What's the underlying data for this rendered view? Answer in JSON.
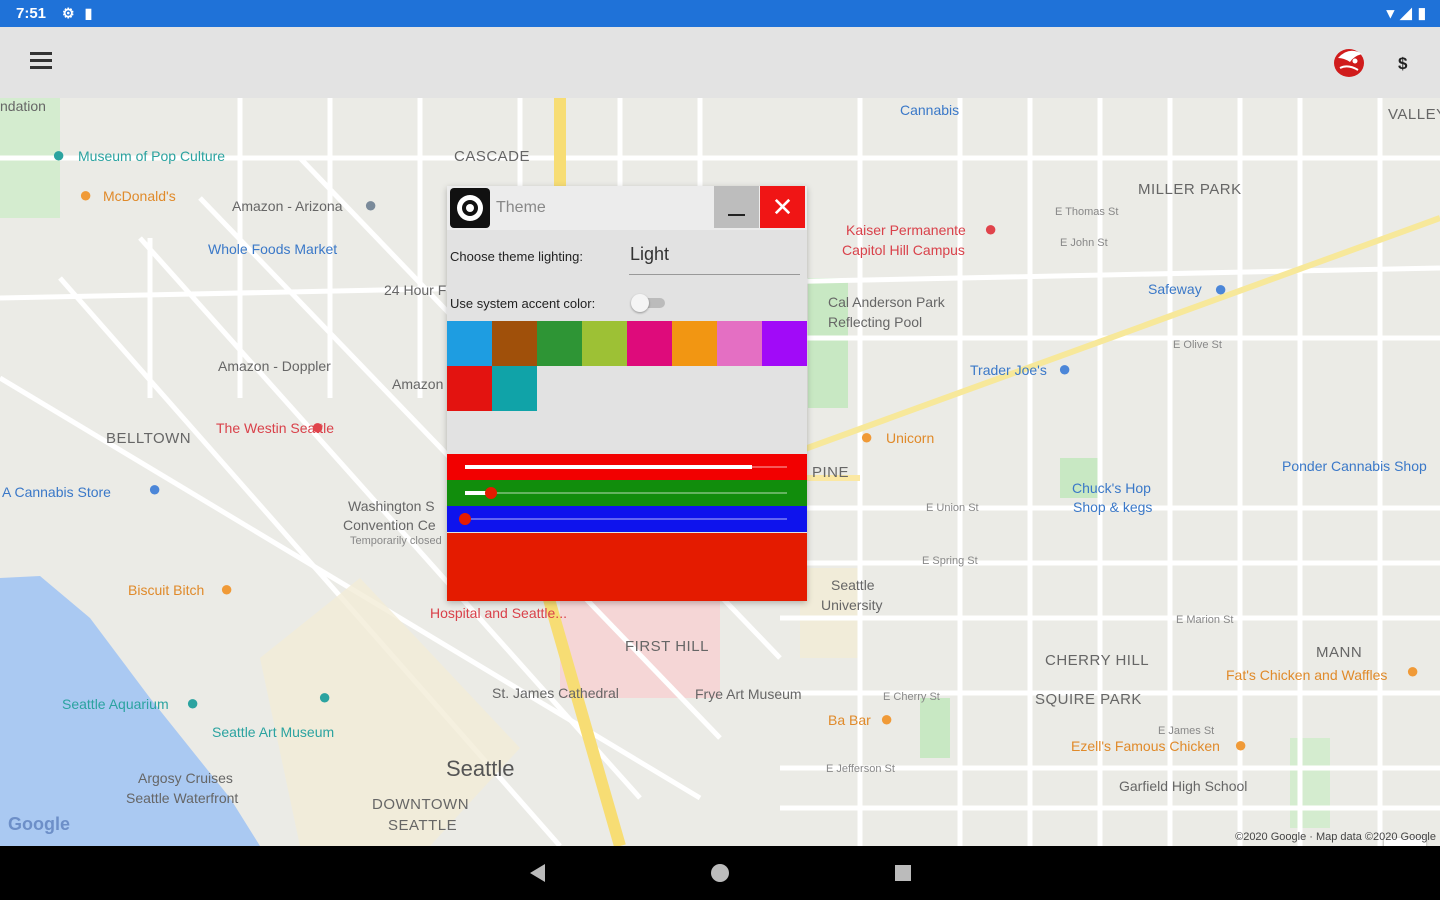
{
  "status_bar": {
    "time": "7:51",
    "icons": [
      "gear-icon",
      "sd-card-icon"
    ],
    "right_icons": [
      "wifi-icon",
      "signal-icon",
      "battery-icon"
    ]
  },
  "app_bar": {
    "currency": "$"
  },
  "dialog": {
    "title": "Theme",
    "close_glyph": "✕",
    "lighting_label": "Choose theme lighting:",
    "lighting_value": "Light",
    "accent_label": "Use system accent color:",
    "accent_toggle_on": false,
    "swatches": [
      "#1e9de1",
      "#a0500a",
      "#2e9535",
      "#9dc135",
      "#de0b7b",
      "#f29612",
      "#e46fc3",
      "#a10af8",
      "#e31310",
      "#10a3a8"
    ],
    "sliders": [
      {
        "name": "red",
        "color": "#f20000",
        "value_fraction": 0.89
      },
      {
        "name": "green",
        "color": "#118d0c",
        "value_fraction": 0.08
      },
      {
        "name": "blue",
        "color": "#0e13ed",
        "value_fraction": 0.0
      }
    ],
    "preview_color": "#e41b00"
  },
  "map": {
    "city_label": "Seattle",
    "areas": [
      "CASCADE",
      "MILLER PARK",
      "BELLTOWN",
      "FIRST HILL",
      "CHERRY HILL",
      "SQUIRE PARK",
      "DOWNTOWN",
      "SEATTLE",
      "MANN",
      "PINE",
      "VALLEY"
    ],
    "pois": [
      "Museum of Pop Culture",
      "McDonald's",
      "Amazon - Arizona",
      "Whole Foods Market",
      "24 Hour F",
      "Amazon - Doppler",
      "Amazon",
      "The Westin Seattle",
      "A Cannabis Store",
      "Washington S",
      "Convention Ce",
      "Biscuit Bitch",
      "Hospital and Seattle...",
      "St. James Cathedral",
      "Frye Art Museum",
      "Seattle Aquarium",
      "Seattle Art Museum",
      "Argosy Cruises",
      "Seattle Waterfront",
      "Cannabis",
      "Kaiser Permanente",
      "Capitol Hill Campus",
      "Cal Anderson Park",
      "Reflecting Pool",
      "Safeway",
      "Trader Joe's",
      "Unicorn",
      "Ponder Cannabis Shop",
      "Chuck's Hop",
      "Shop & kegs",
      "Seattle",
      "University",
      "Fat's Chicken and Waffles",
      "Ba Bar",
      "Ezell's Famous Chicken",
      "Garfield High School",
      "ndation"
    ],
    "small_labels": [
      "Temporarily closed",
      "E Thomas St",
      "E John St",
      "E Olive St",
      "E Union St",
      "E Spring St",
      "E Marion St",
      "E Cherry St",
      "E James St",
      "E Jefferson St"
    ],
    "copyright": "©2020 Google · Map data ©2020 Google",
    "google_logo": "Google",
    "zoom_in": "+",
    "zoom_out": "−"
  }
}
